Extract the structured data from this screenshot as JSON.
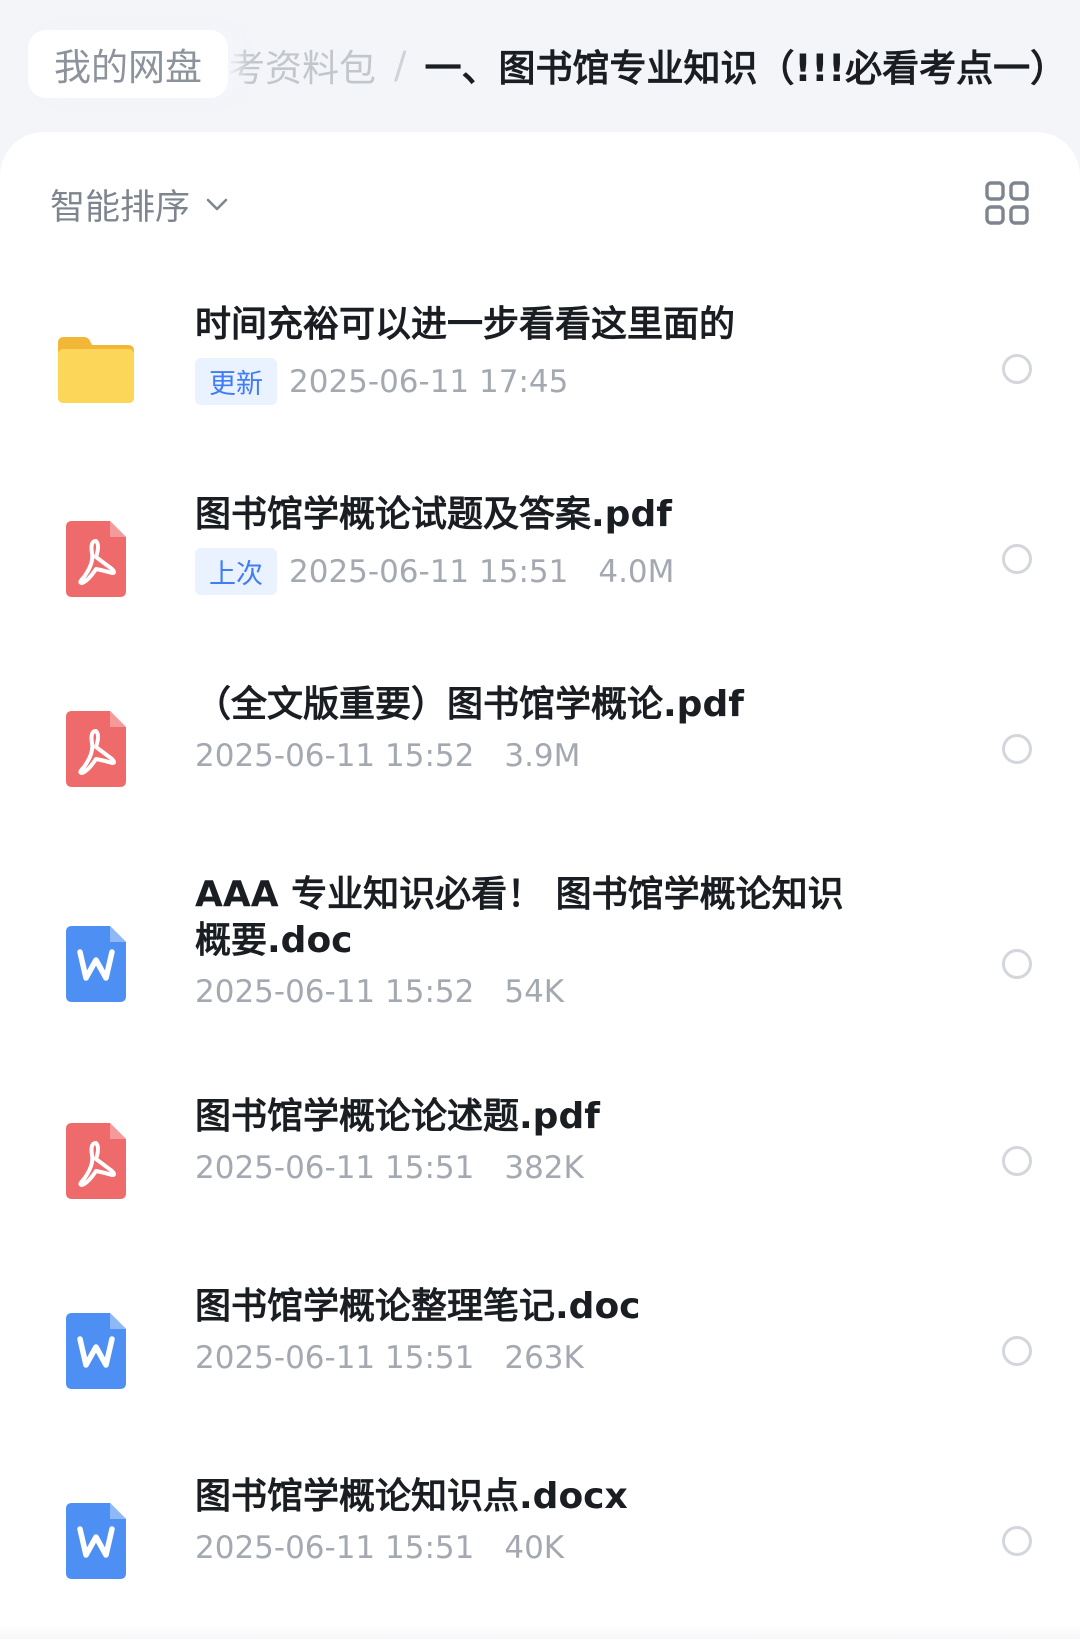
{
  "breadcrumb": {
    "home": "我的网盘",
    "parent": "考资料包",
    "separator": "/",
    "current": "一、图书馆专业知识（!!!必看考点一）"
  },
  "toolbar": {
    "sort_label": "智能排序",
    "sort_icon": "chevron-down-icon",
    "view_icon": "grid-view-icon"
  },
  "colors": {
    "folder": "#f7c948",
    "pdf": "#ef6464",
    "word": "#4a8df0",
    "badge_text": "#3f7cf5",
    "badge_bg": "#eaf2ff"
  },
  "files": [
    {
      "type": "folder",
      "icon": "folder-icon",
      "name": "时间充裕可以进一步看看这里面的",
      "badge": "更新",
      "date": "2025-06-11 17:45",
      "size": ""
    },
    {
      "type": "pdf",
      "icon": "pdf-icon",
      "name": "图书馆学概论试题及答案.pdf",
      "badge": "上次",
      "date": "2025-06-11 15:51",
      "size": "4.0M"
    },
    {
      "type": "pdf",
      "icon": "pdf-icon",
      "name": "（全文版重要）图书馆学概论.pdf",
      "badge": "",
      "date": "2025-06-11 15:52",
      "size": "3.9M"
    },
    {
      "type": "word",
      "icon": "word-icon",
      "name": "AAA 专业知识必看！ 图书馆学概论知识概要.doc",
      "badge": "",
      "date": "2025-06-11 15:52",
      "size": "54K"
    },
    {
      "type": "pdf",
      "icon": "pdf-icon",
      "name": "图书馆学概论论述题.pdf",
      "badge": "",
      "date": "2025-06-11 15:51",
      "size": "382K"
    },
    {
      "type": "word",
      "icon": "word-icon",
      "name": "图书馆学概论整理笔记.doc",
      "badge": "",
      "date": "2025-06-11 15:51",
      "size": "263K"
    },
    {
      "type": "word",
      "icon": "word-icon",
      "name": "图书馆学概论知识点.docx",
      "badge": "",
      "date": "2025-06-11 15:51",
      "size": "40K"
    }
  ]
}
